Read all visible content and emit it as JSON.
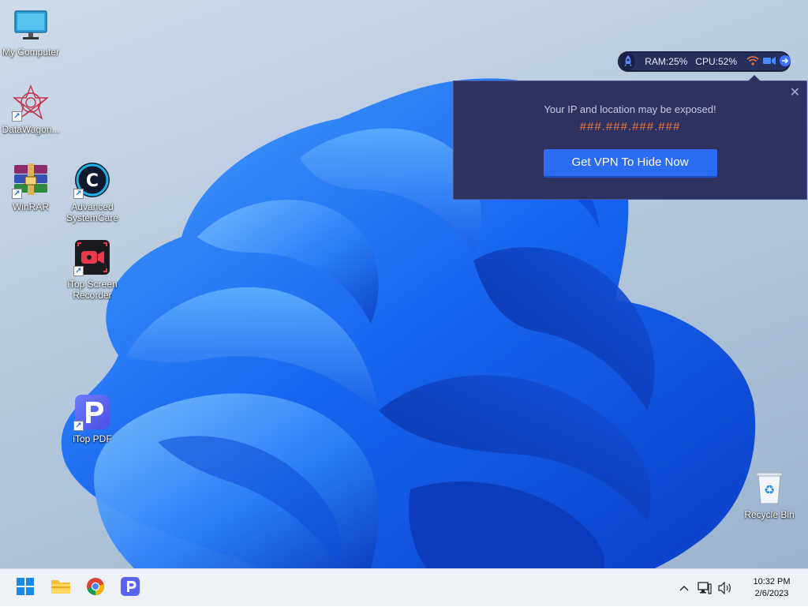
{
  "desktop": {
    "icons": [
      {
        "name": "my-computer",
        "label": "My Computer"
      },
      {
        "name": "datawagon",
        "label": "DataWagon..."
      },
      {
        "name": "winrar",
        "label": "WinRAR"
      },
      {
        "name": "advanced-systemcare",
        "label": "Advanced SystemCare"
      },
      {
        "name": "itop-screen-recorder",
        "label": "iTop Screen Recorder"
      },
      {
        "name": "itop-pdf",
        "label": "iTop PDF"
      },
      {
        "name": "recycle-bin",
        "label": "Recycle Bin"
      }
    ]
  },
  "monitor": {
    "ram_label": "RAM:",
    "ram_value": "25%",
    "cpu_label": "CPU:",
    "cpu_value": "52%"
  },
  "vpn_popup": {
    "message": "Your IP and location may be exposed!",
    "ip_mask": "###.###.###.###",
    "button_label": "Get VPN To Hide Now",
    "close_glyph": "✕"
  },
  "taskbar": {
    "pinned": [
      "start-icon",
      "file-explorer-icon",
      "chrome-icon",
      "itop-pdf-icon"
    ]
  },
  "tray": {
    "chevron": "^",
    "time": "10:32 PM",
    "date": "2/6/2023"
  },
  "colors": {
    "accent_button": "#2b6cf2",
    "ip_text": "#f07a3a",
    "popup_bg": "#2f3260"
  }
}
